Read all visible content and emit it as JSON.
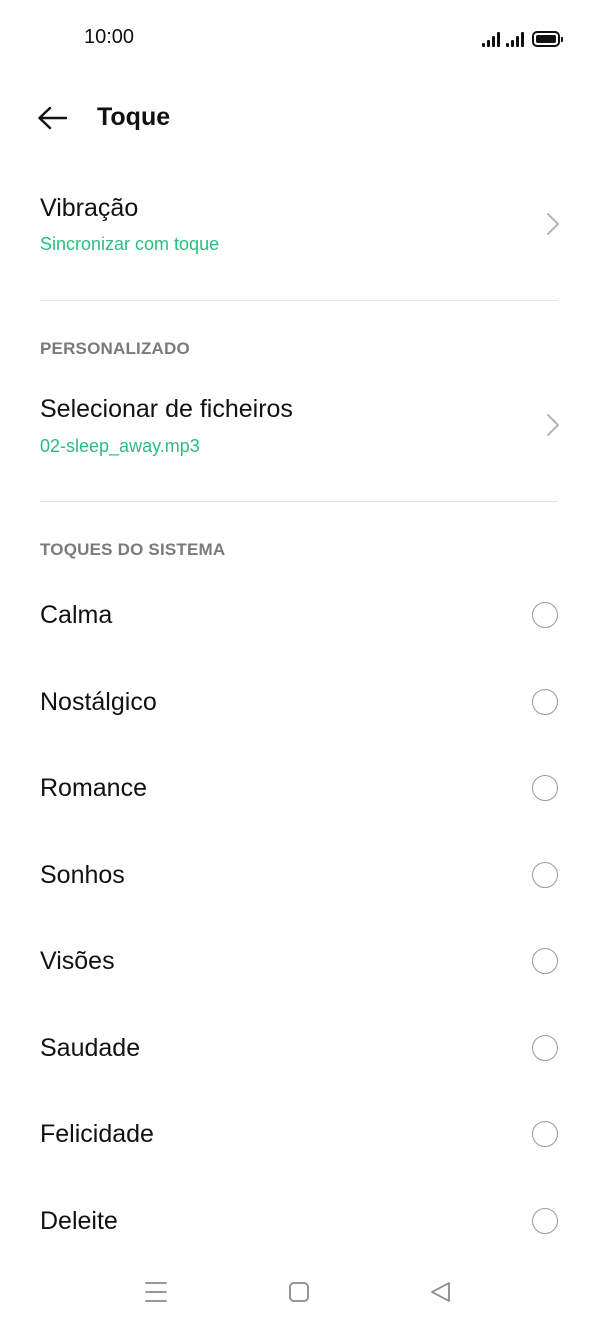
{
  "status_bar": {
    "time": "10:00"
  },
  "header": {
    "title": "Toque",
    "back_icon": "arrow-left-icon"
  },
  "vibration": {
    "title": "Vibração",
    "value": "Sincronizar com toque"
  },
  "custom_section": {
    "header": "PERSONALIZADO",
    "item_title": "Selecionar de ficheiros",
    "item_value": "02-sleep_away.mp3"
  },
  "system_section": {
    "header": "TOQUES DO SISTEMA",
    "tones": [
      {
        "label": "Calma",
        "selected": false
      },
      {
        "label": "Nostálgico",
        "selected": false
      },
      {
        "label": "Romance",
        "selected": false
      },
      {
        "label": "Sonhos",
        "selected": false
      },
      {
        "label": "Visões",
        "selected": false
      },
      {
        "label": "Saudade",
        "selected": false
      },
      {
        "label": "Felicidade",
        "selected": false
      },
      {
        "label": "Deleite",
        "selected": false
      }
    ]
  },
  "nav_bar": {
    "icons": [
      "menu-icon",
      "home-icon",
      "back-triangle-icon"
    ]
  },
  "colors": {
    "accent": "#2bbd7e",
    "section_header": "#7a7a7a",
    "text": "#111111",
    "divider": "#e6e6e6"
  }
}
